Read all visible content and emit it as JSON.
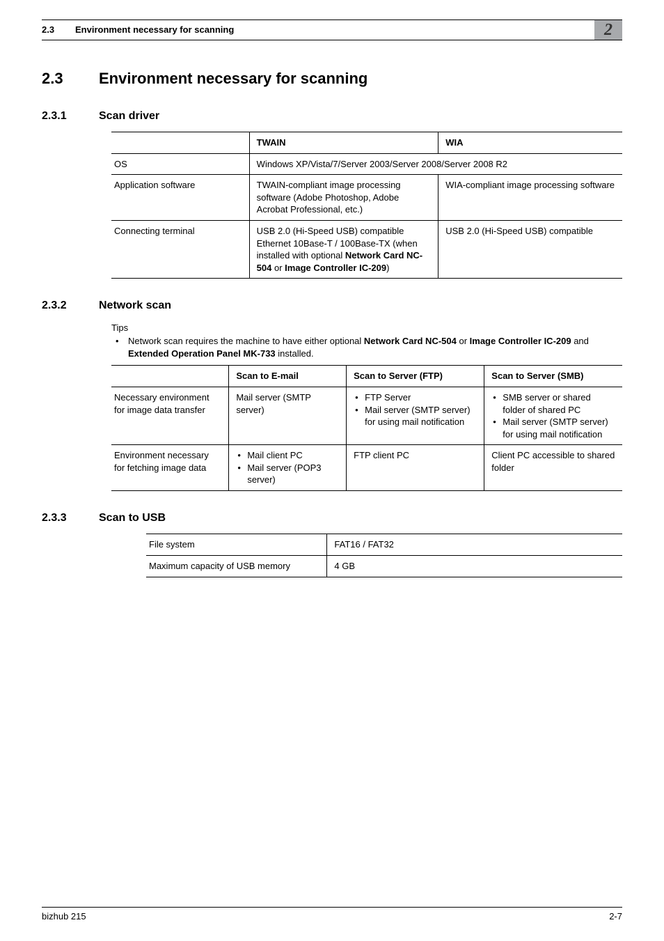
{
  "chapter_badge": "2",
  "header": {
    "section_number": "2.3",
    "section_title": "Environment necessary for scanning"
  },
  "section": {
    "number": "2.3",
    "title": "Environment necessary for scanning"
  },
  "sub1": {
    "number": "2.3.1",
    "title": "Scan driver",
    "table": {
      "head": [
        "",
        "TWAIN",
        "WIA"
      ],
      "rows": [
        {
          "label": "OS",
          "twain": "Windows XP/Vista/7/Server 2003/Server 2008/Server 2008 R2",
          "wia": null,
          "span": true
        },
        {
          "label": "Application software",
          "twain": "TWAIN-compliant image processing software (Adobe Photoshop, Adobe Acrobat Professional, etc.)",
          "wia": "WIA-compliant image processing software"
        },
        {
          "label": "Connecting terminal",
          "twain_pre": "USB 2.0 (Hi-Speed USB) compatible\nEthernet 10Base-T / 100Base-TX (when installed with optional ",
          "twain_bold": "Network Card NC-504",
          "twain_mid": " or ",
          "twain_bold2": "Image Controller IC-209",
          "twain_post": ")",
          "wia": "USB 2.0 (Hi-Speed USB) compatible"
        }
      ]
    }
  },
  "sub2": {
    "number": "2.3.2",
    "title": "Network scan",
    "tips_label": "Tips",
    "tip_pre": "Network scan requires the machine to have either optional ",
    "tip_b1": "Network Card NC-504",
    "tip_mid1": " or ",
    "tip_b2": "Image Controller IC-209",
    "tip_mid2": " and ",
    "tip_b3": "Extended Operation Panel MK-733",
    "tip_post": " installed.",
    "table": {
      "head": [
        "",
        "Scan to E-mail",
        "Scan to Server (FTP)",
        "Scan to Server (SMB)"
      ],
      "rows": [
        {
          "label": "Necessary environment for image data transfer",
          "email": "Mail server (SMTP server)",
          "ftp": [
            "FTP Server",
            "Mail server (SMTP server) for using mail notification"
          ],
          "smb": [
            "SMB server or shared folder of shared PC",
            "Mail server (SMTP server) for using mail notification"
          ]
        },
        {
          "label": "Environment necessary for fetching image data",
          "email_list": [
            "Mail client PC",
            "Mail server (POP3 server)"
          ],
          "ftp_text": "FTP client PC",
          "smb_text": "Client PC accessible to shared folder"
        }
      ]
    }
  },
  "sub3": {
    "number": "2.3.3",
    "title": "Scan to USB",
    "rows": [
      {
        "k": "File system",
        "v": "FAT16 / FAT32"
      },
      {
        "k": "Maximum capacity of USB memory",
        "v": "4 GB"
      }
    ]
  },
  "footer": {
    "left": "bizhub 215",
    "right": "2-7"
  }
}
